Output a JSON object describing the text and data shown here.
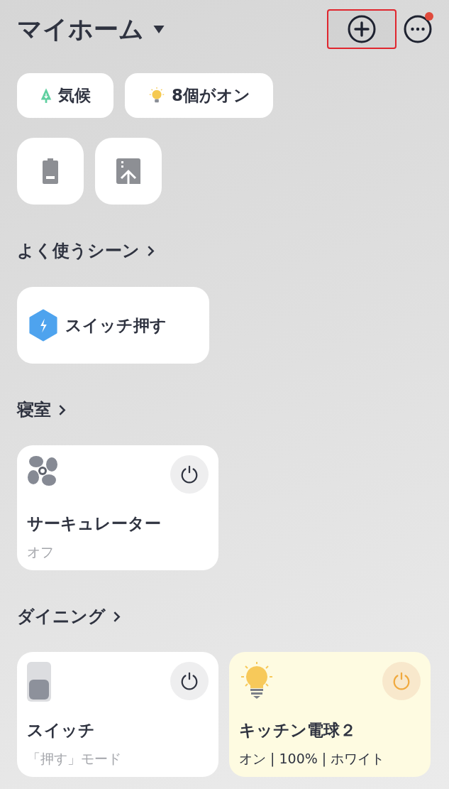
{
  "header": {
    "title": "マイホーム",
    "add_highlighted": true,
    "more_badge": true
  },
  "chips": [
    {
      "kind": "climate",
      "label": "気候"
    },
    {
      "kind": "lights",
      "label": "8個がオン"
    }
  ],
  "tiles": [
    {
      "kind": "battery"
    },
    {
      "kind": "upload"
    }
  ],
  "scenes": {
    "title": "よく使うシーン",
    "items": [
      {
        "label": "スイッチ押す"
      }
    ]
  },
  "rooms": [
    {
      "name": "寝室",
      "devices": [
        {
          "kind": "fan",
          "name": "サーキュレーター",
          "status": "オフ",
          "on": false
        }
      ]
    },
    {
      "name": "ダイニング",
      "devices": [
        {
          "kind": "switch",
          "name": "スイッチ",
          "status": "「押す」モード",
          "on": false
        },
        {
          "kind": "bulb",
          "name": "キッチン電球２",
          "status": "オン | 100% | ホワイト",
          "on": true
        }
      ]
    }
  ]
}
